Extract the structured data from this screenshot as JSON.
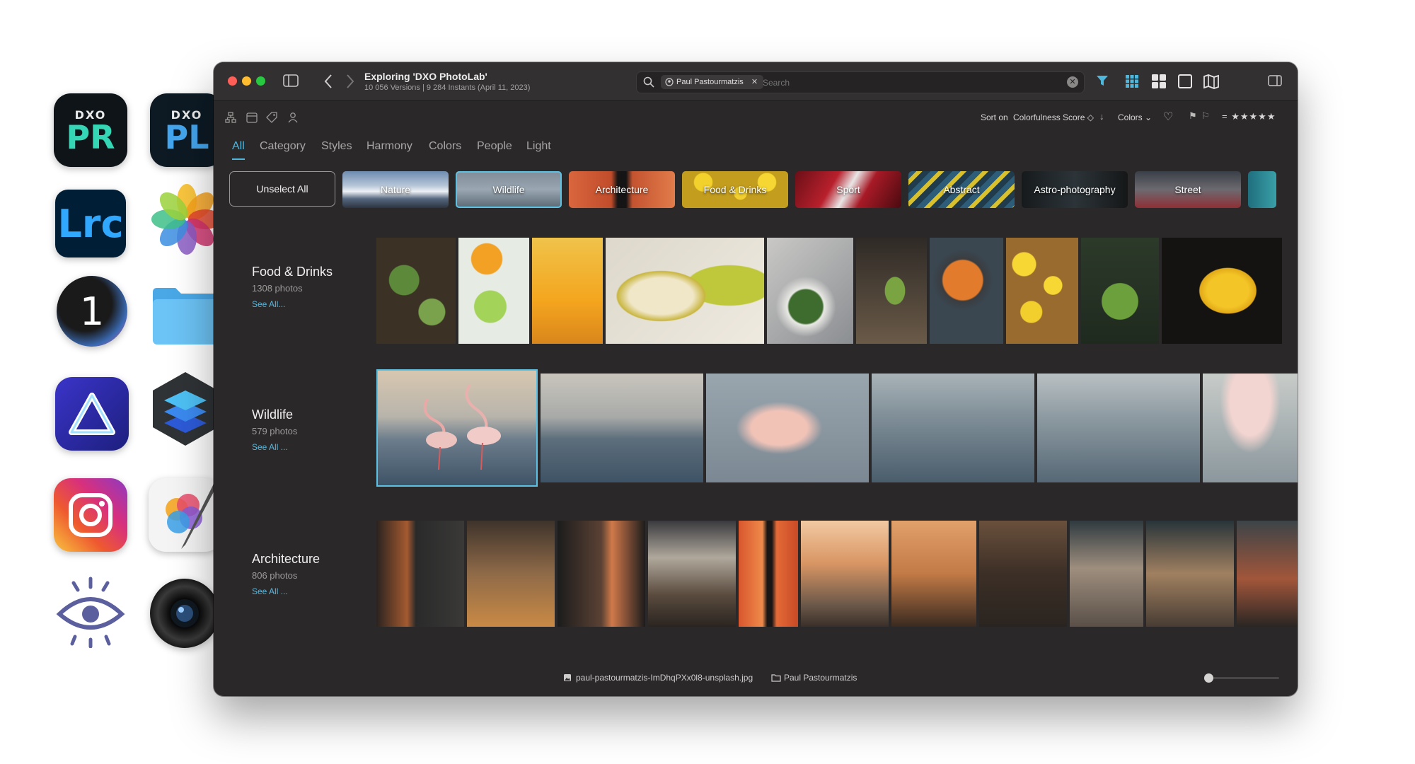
{
  "window": {
    "title": "Exploring 'DXO PhotoLab'",
    "subtitle": "10 056 Versions  |  9 284 Instants (April 11, 2023)"
  },
  "search": {
    "chip_label": "Paul Pastourmatzis",
    "placeholder": "Search"
  },
  "sort": {
    "label": "Sort on",
    "value": "Colorfulness Score ◇",
    "colors_label": "Colors ⌄",
    "rating_display": "= ★★★★★"
  },
  "tabs": [
    {
      "label": "All",
      "active": true
    },
    {
      "label": "Category"
    },
    {
      "label": "Styles"
    },
    {
      "label": "Harmony"
    },
    {
      "label": "Colors"
    },
    {
      "label": "People"
    },
    {
      "label": "Light"
    }
  ],
  "unselect_label": "Unselect All",
  "categories": [
    {
      "label": "Nature"
    },
    {
      "label": "Wildlife",
      "selected": true
    },
    {
      "label": "Architecture"
    },
    {
      "label": "Food & Drinks"
    },
    {
      "label": "Sport"
    },
    {
      "label": "Abstract"
    },
    {
      "label": "Astro-photography"
    },
    {
      "label": "Street"
    }
  ],
  "rows": [
    {
      "title": "Food & Drinks",
      "count": "1308 photos",
      "see_all": "See All..."
    },
    {
      "title": "Wildlife",
      "count": "579 photos",
      "see_all": "See All ..."
    },
    {
      "title": "Architecture",
      "count": "806 photos",
      "see_all": "See All ..."
    }
  ],
  "status": {
    "file_name": "paul-pastourmatzis-ImDhqPXx0l8-unsplash.jpg",
    "folder_name": "Paul Pastourmatzis"
  },
  "apps": [
    {
      "name": "dxo-pureraw",
      "top": "DXO",
      "main": "PR"
    },
    {
      "name": "dxo-photolab",
      "top": "DXO",
      "main": "PL"
    },
    {
      "name": "lightroom-classic",
      "main": "Lrc"
    },
    {
      "name": "apple-photos"
    },
    {
      "name": "capture-one",
      "main": "1"
    },
    {
      "name": "finder-folder"
    },
    {
      "name": "luminar"
    },
    {
      "name": "layers-app"
    },
    {
      "name": "instagram"
    },
    {
      "name": "pixelmator-pro"
    },
    {
      "name": "eye-app"
    },
    {
      "name": "aperture-camera"
    }
  ]
}
